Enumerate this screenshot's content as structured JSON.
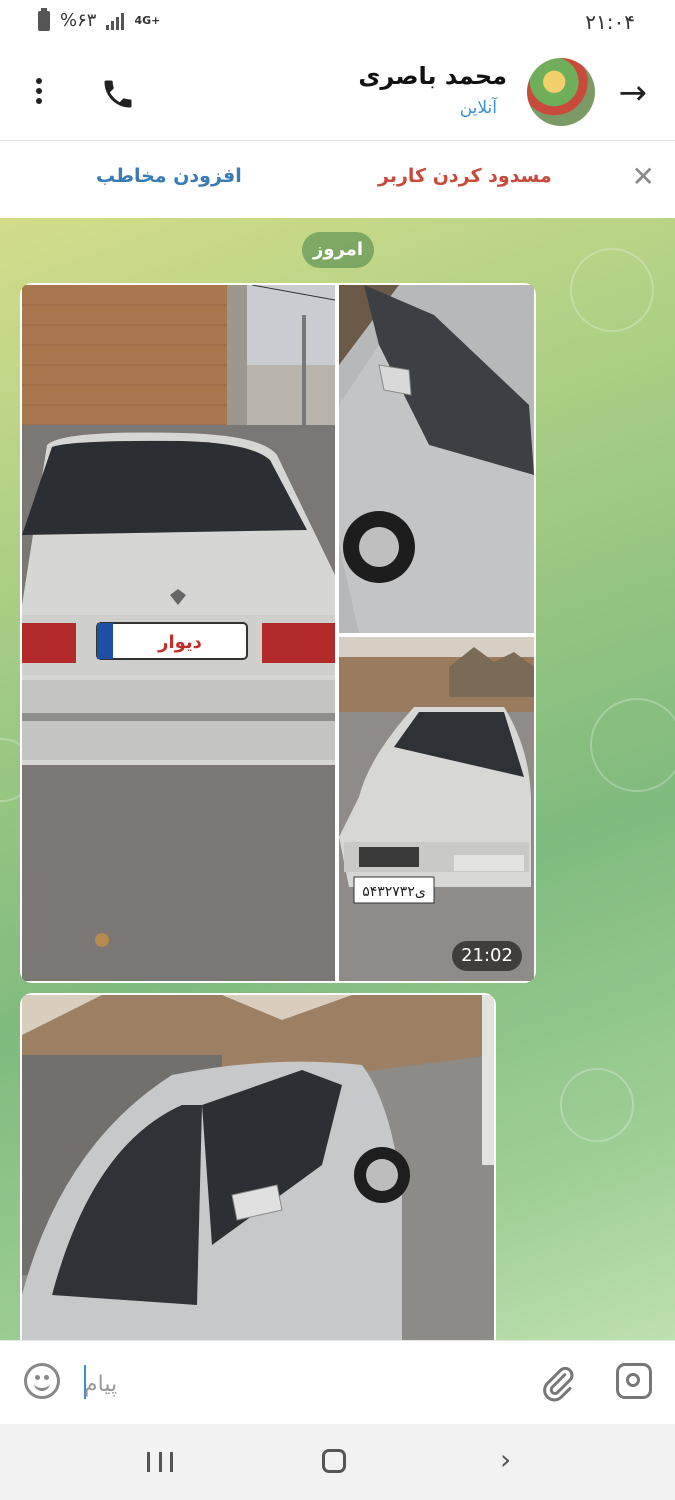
{
  "status_bar": {
    "time": "۲۱:۰۴",
    "battery": "%۶۳",
    "network": "4G+"
  },
  "header": {
    "contact_name": "محمد باصری",
    "status": "آنلاین"
  },
  "action_bar": {
    "block_label": "مسدود کردن کاربر",
    "add_contact_label": "افزودن مخاطب"
  },
  "chat": {
    "date_label": "امروز",
    "album_time": "21:02",
    "plate_text": "دیوار",
    "plate_number": "۵۴ی۳۲۷۳۲"
  },
  "composer": {
    "placeholder": "پیام"
  },
  "colors": {
    "accent_blue": "#3a8fd0",
    "block_red": "#c84a3c",
    "add_contact_blue": "#3b7bb3"
  }
}
